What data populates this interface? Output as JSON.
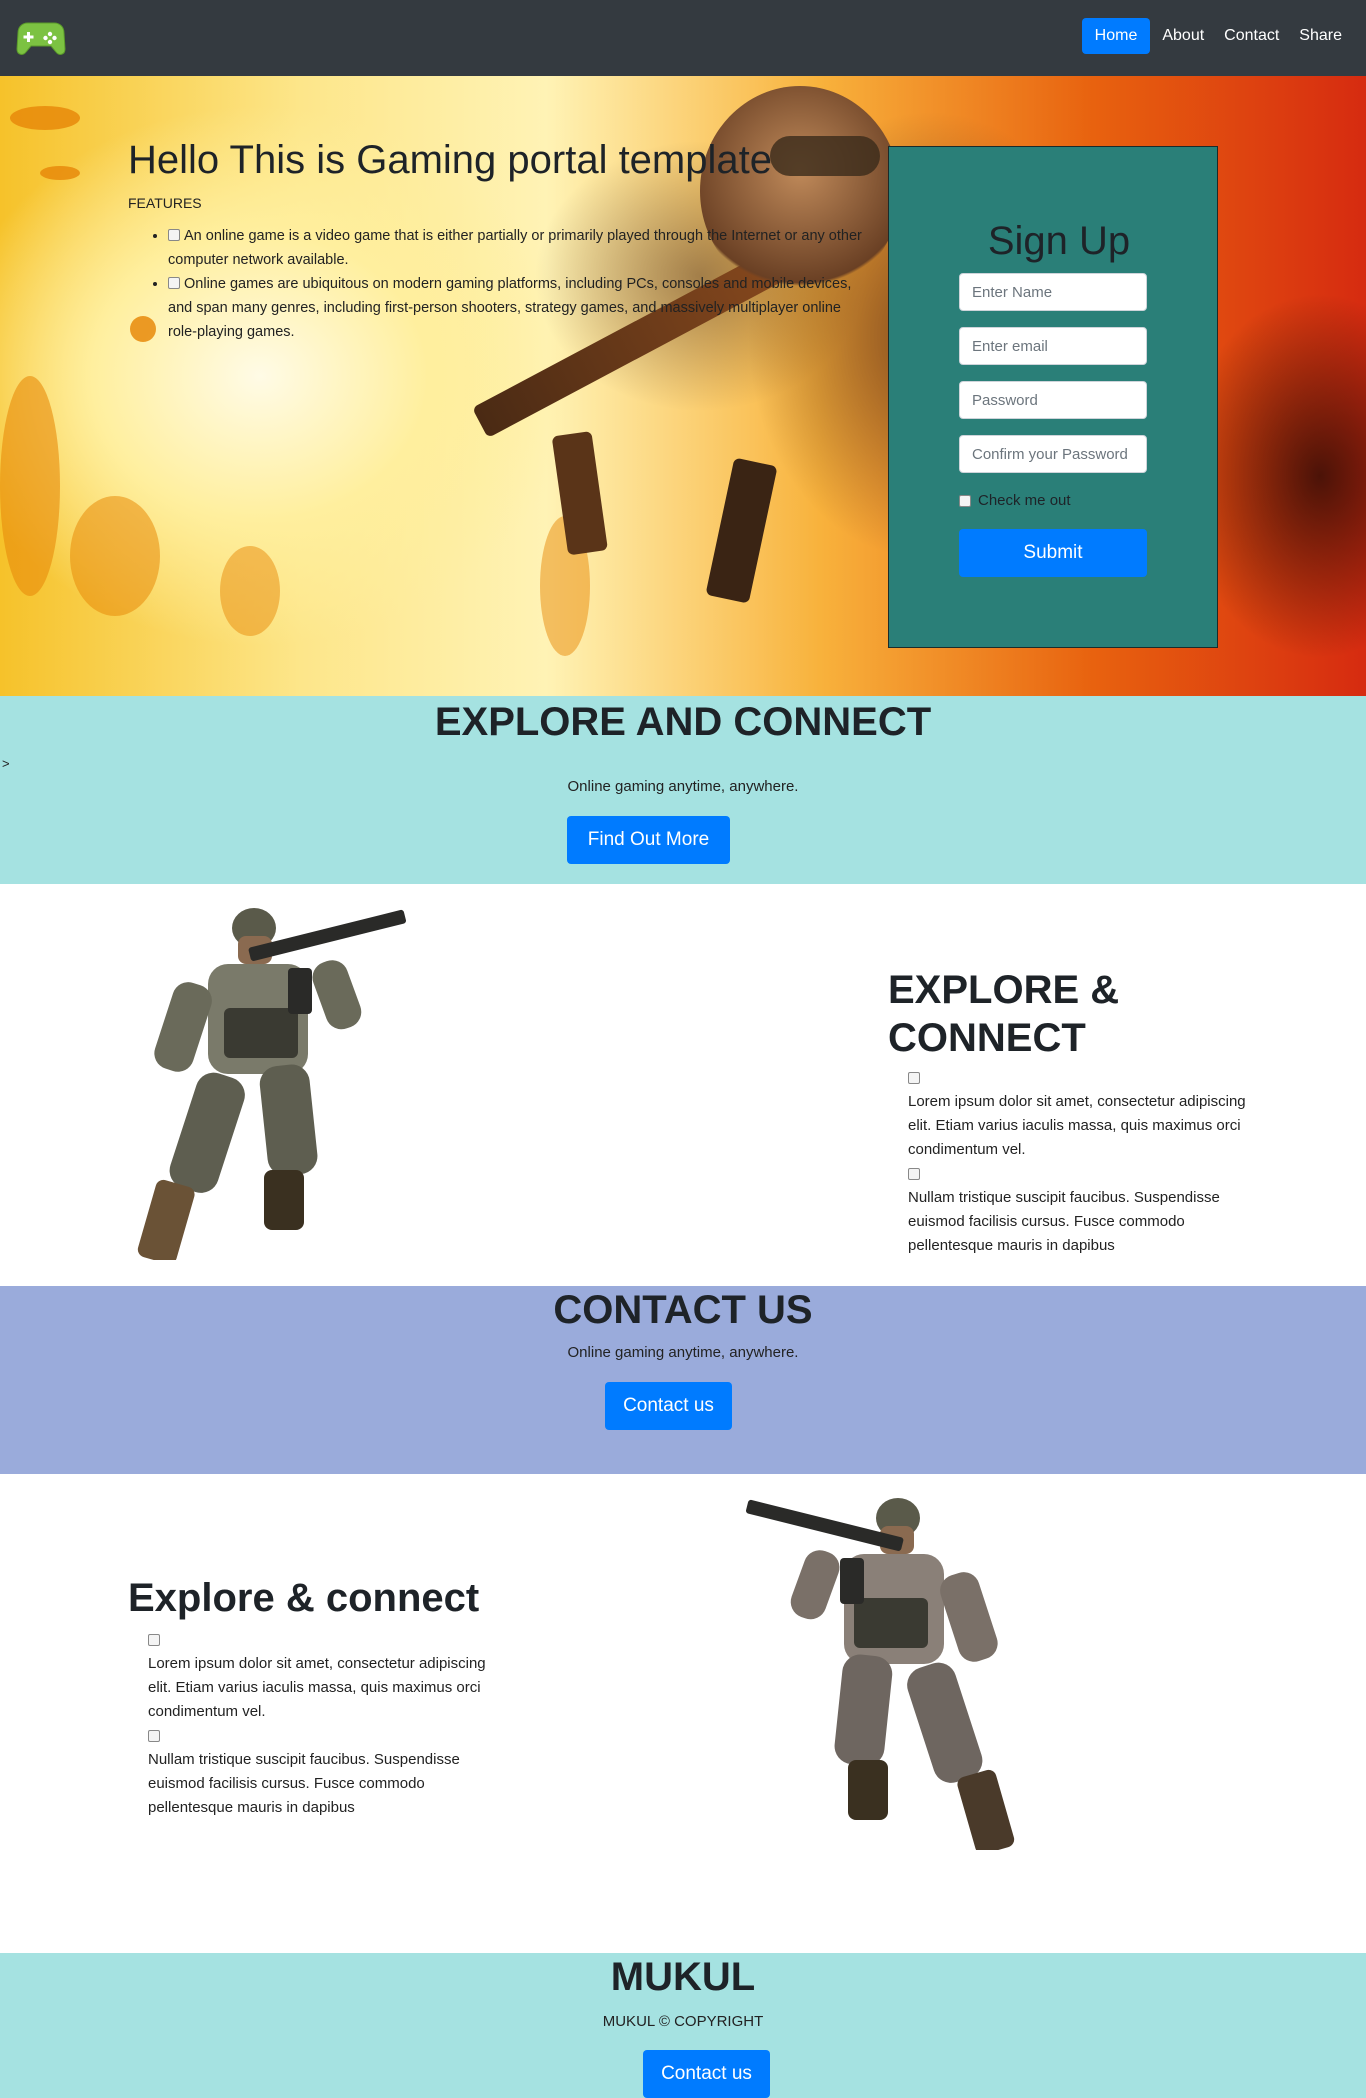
{
  "nav": {
    "logo_icon": "gamepad-icon",
    "links": [
      "Home",
      "About",
      "Contact",
      "Share"
    ],
    "active": "Home"
  },
  "hero": {
    "title": "Hello This is Gaming portal template",
    "features_label": "FEATURES",
    "features": [
      "An online game is a video game that is either partially or primarily played through the Internet or any other computer network available.",
      "Online games are ubiquitous on modern gaming platforms, including PCs, consoles and mobile devices, and span many genres, including first-person shooters, strategy games, and massively multiplayer online role-playing games."
    ]
  },
  "signup": {
    "title": "Sign Up",
    "name_placeholder": "Enter Name",
    "email_placeholder": "Enter email",
    "password_placeholder": "Password",
    "confirm_placeholder": "Confirm your Password",
    "check_label": "Check me out",
    "submit_label": "Submit"
  },
  "explore_band": {
    "stray_text": ">",
    "title": "EXPLORE AND CONNECT",
    "subtitle": "Online gaming anytime, anywhere.",
    "button": "Find Out More"
  },
  "section1": {
    "title": "EXPLORE & CONNECT",
    "items": [
      "Lorem ipsum dolor sit amet, consectetur adipiscing elit. Etiam varius iaculis massa, quis maximus orci condimentum vel.",
      "Nullam tristique suscipit faucibus. Suspendisse euismod facilisis cursus. Fusce commodo pellentesque mauris in dapibus"
    ]
  },
  "contact_band": {
    "title": "CONTACT US",
    "subtitle": "Online gaming anytime, anywhere.",
    "button": "Contact us"
  },
  "section2": {
    "title": "Explore & connect",
    "items": [
      "Lorem ipsum dolor sit amet, consectetur adipiscing elit. Etiam varius iaculis massa, quis maximus orci condimentum vel.",
      "Nullam tristique suscipit faucibus. Suspendisse euismod facilisis cursus. Fusce commodo pellentesque mauris in dapibus"
    ]
  },
  "footer": {
    "title": "MUKUL",
    "copyright": "MUKUL © COPYRIGHT",
    "button": "Contact us"
  },
  "colors": {
    "navbar": "#343a40",
    "primary": "#007bff",
    "signup_bg": "#2a7f78",
    "band_teal": "#a5e2e1",
    "band_blue": "#9aabdb"
  }
}
